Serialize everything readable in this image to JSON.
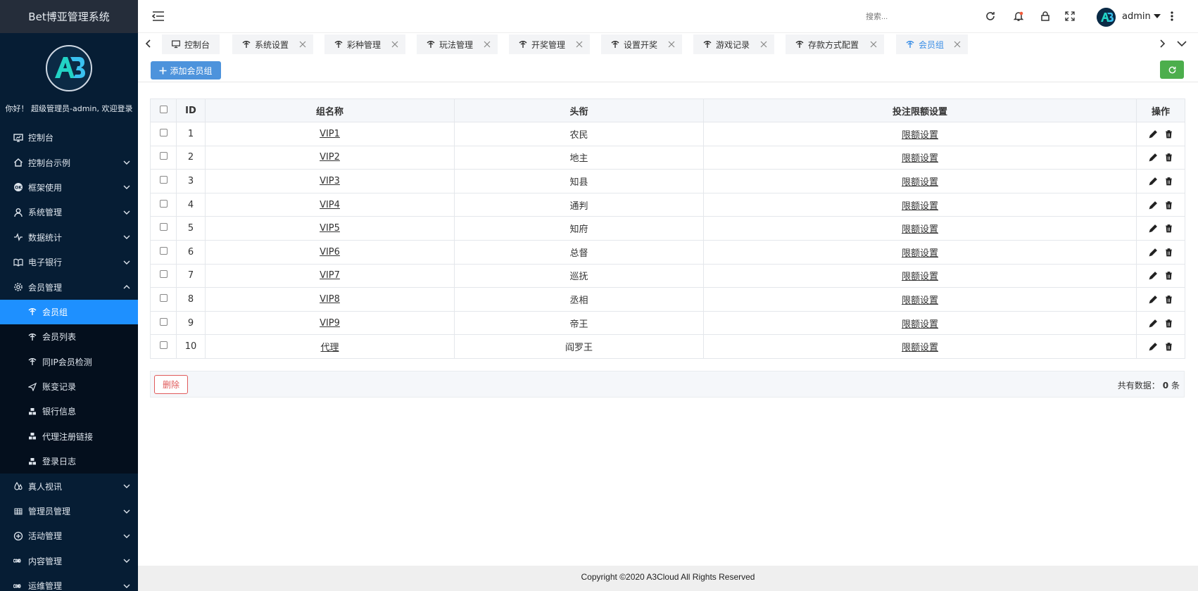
{
  "app": {
    "title": "Bet博亚管理系统",
    "welcome": "你好！ 超级管理员-admin, 欢迎登录"
  },
  "sidebar": {
    "items": [
      {
        "label": "控制台",
        "icon": "monitor-icon"
      },
      {
        "label": "控制台示例",
        "icon": "home-icon"
      },
      {
        "label": "框架使用",
        "icon": "ok-icon"
      },
      {
        "label": "系统管理",
        "icon": "user-icon"
      },
      {
        "label": "数据统计",
        "icon": "pulse-icon"
      },
      {
        "label": "电子银行",
        "icon": "book-icon"
      },
      {
        "label": "会员管理",
        "icon": "gear-icon"
      },
      {
        "label": "会员组",
        "icon": "group-icon"
      },
      {
        "label": "会员列表",
        "icon": "group-icon"
      },
      {
        "label": "同IP会员检测",
        "icon": "group-icon"
      },
      {
        "label": "账变记录",
        "icon": "send-icon"
      },
      {
        "label": "银行信息",
        "icon": "cubes-icon"
      },
      {
        "label": "代理注册链接",
        "icon": "cubes-icon"
      },
      {
        "label": "登录日志",
        "icon": "cubes-icon"
      },
      {
        "label": "真人视讯",
        "icon": "drop-icon"
      },
      {
        "label": "管理员管理",
        "icon": "grid-icon"
      },
      {
        "label": "活动管理",
        "icon": "plus-circle-icon"
      },
      {
        "label": "内容管理",
        "icon": "infinity-icon"
      },
      {
        "label": "运维管理",
        "icon": "infinity-icon"
      }
    ]
  },
  "header": {
    "search_placeholder": "搜索...",
    "username": "admin"
  },
  "tabs": [
    {
      "label": "控制台"
    },
    {
      "label": "系统设置"
    },
    {
      "label": "彩种管理"
    },
    {
      "label": "玩法管理"
    },
    {
      "label": "开奖管理"
    },
    {
      "label": "设置开奖"
    },
    {
      "label": "游戏记录"
    },
    {
      "label": "存款方式配置"
    },
    {
      "label": "会员组"
    }
  ],
  "toolbar": {
    "add_label": "添加会员组"
  },
  "table": {
    "headers": {
      "id": "ID",
      "name": "组名称",
      "title": "头衔",
      "limit": "投注限额设置",
      "ops": "操作"
    },
    "rows": [
      {
        "id": "1",
        "name": "VIP1",
        "title": "农民",
        "limit": "限额设置"
      },
      {
        "id": "2",
        "name": "VIP2",
        "title": "地主",
        "limit": "限额设置"
      },
      {
        "id": "3",
        "name": "VIP3",
        "title": "知县",
        "limit": "限额设置"
      },
      {
        "id": "4",
        "name": "VIP4",
        "title": "通判",
        "limit": "限额设置"
      },
      {
        "id": "5",
        "name": "VIP5",
        "title": "知府",
        "limit": "限额设置"
      },
      {
        "id": "6",
        "name": "VIP6",
        "title": "总督",
        "limit": "限额设置"
      },
      {
        "id": "7",
        "name": "VIP7",
        "title": "巡抚",
        "limit": "限额设置"
      },
      {
        "id": "8",
        "name": "VIP8",
        "title": "丞相",
        "limit": "限额设置"
      },
      {
        "id": "9",
        "name": "VIP9",
        "title": "帝王",
        "limit": "限额设置"
      },
      {
        "id": "10",
        "name": "代理",
        "title": "阎罗王",
        "limit": "限额设置"
      }
    ]
  },
  "footer": {
    "delete_label": "删除",
    "total_label": "共有数据：",
    "total_count": "0",
    "total_unit": "条"
  },
  "copyright": "Copyright ©2020 A3Cloud All Rights Reserved",
  "colors": {
    "sidebar_bg": "#061d34",
    "active": "#1e90ff",
    "primary": "#4d93dc",
    "success": "#4cae4c",
    "danger": "#e05a5a"
  }
}
